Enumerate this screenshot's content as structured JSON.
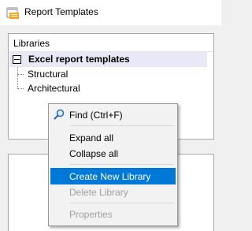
{
  "window": {
    "title": "Report Templates"
  },
  "libraries_panel": {
    "header": "Libraries",
    "root": {
      "label": "Excel report templates",
      "expanded": true
    },
    "children": [
      "Structural",
      "Architectural"
    ]
  },
  "context_menu": {
    "items": {
      "find": {
        "label": "Find (Ctrl+F)",
        "icon": "magnifier-icon"
      },
      "expand_all": {
        "label": "Expand all"
      },
      "collapse_all": {
        "label": "Collapse all"
      },
      "create_new_library": {
        "label": "Create New Library",
        "highlighted": true
      },
      "delete_library": {
        "label": "Delete Library",
        "disabled": true
      },
      "properties": {
        "label": "Properties",
        "disabled": true
      }
    }
  },
  "colors": {
    "highlight": "#0078d7",
    "selected_row": "#e8e8f6",
    "disabled_text": "#a0a0a0"
  }
}
